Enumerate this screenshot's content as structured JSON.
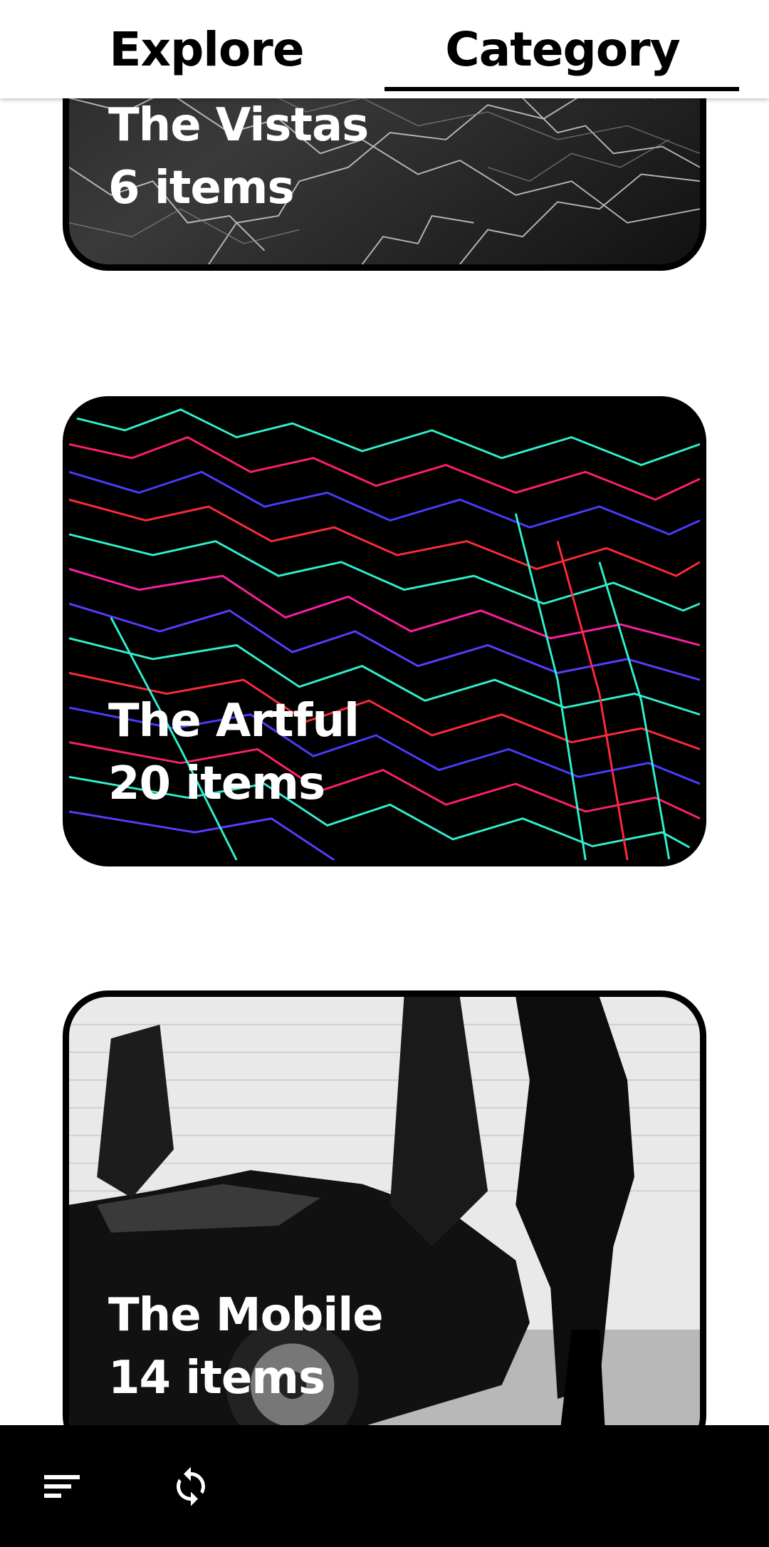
{
  "tabs": {
    "explore_label": "Explore",
    "category_label": "Category",
    "selected": "Category"
  },
  "categories": [
    {
      "title": "The Vistas",
      "count": "6 items",
      "image": "black-marble"
    },
    {
      "title": "The Artful",
      "count": "20 items",
      "image": "neon-topography-lines"
    },
    {
      "title": "The Mobile",
      "count": "14 items",
      "image": "monochrome-sports-car"
    }
  ],
  "bottom_bar": {
    "menu_icon": "sort-menu-icon",
    "refresh_icon": "sync-icon"
  },
  "colors": {
    "background": "#ffffff",
    "bar": "#000000",
    "text_on_card": "#ffffff"
  }
}
